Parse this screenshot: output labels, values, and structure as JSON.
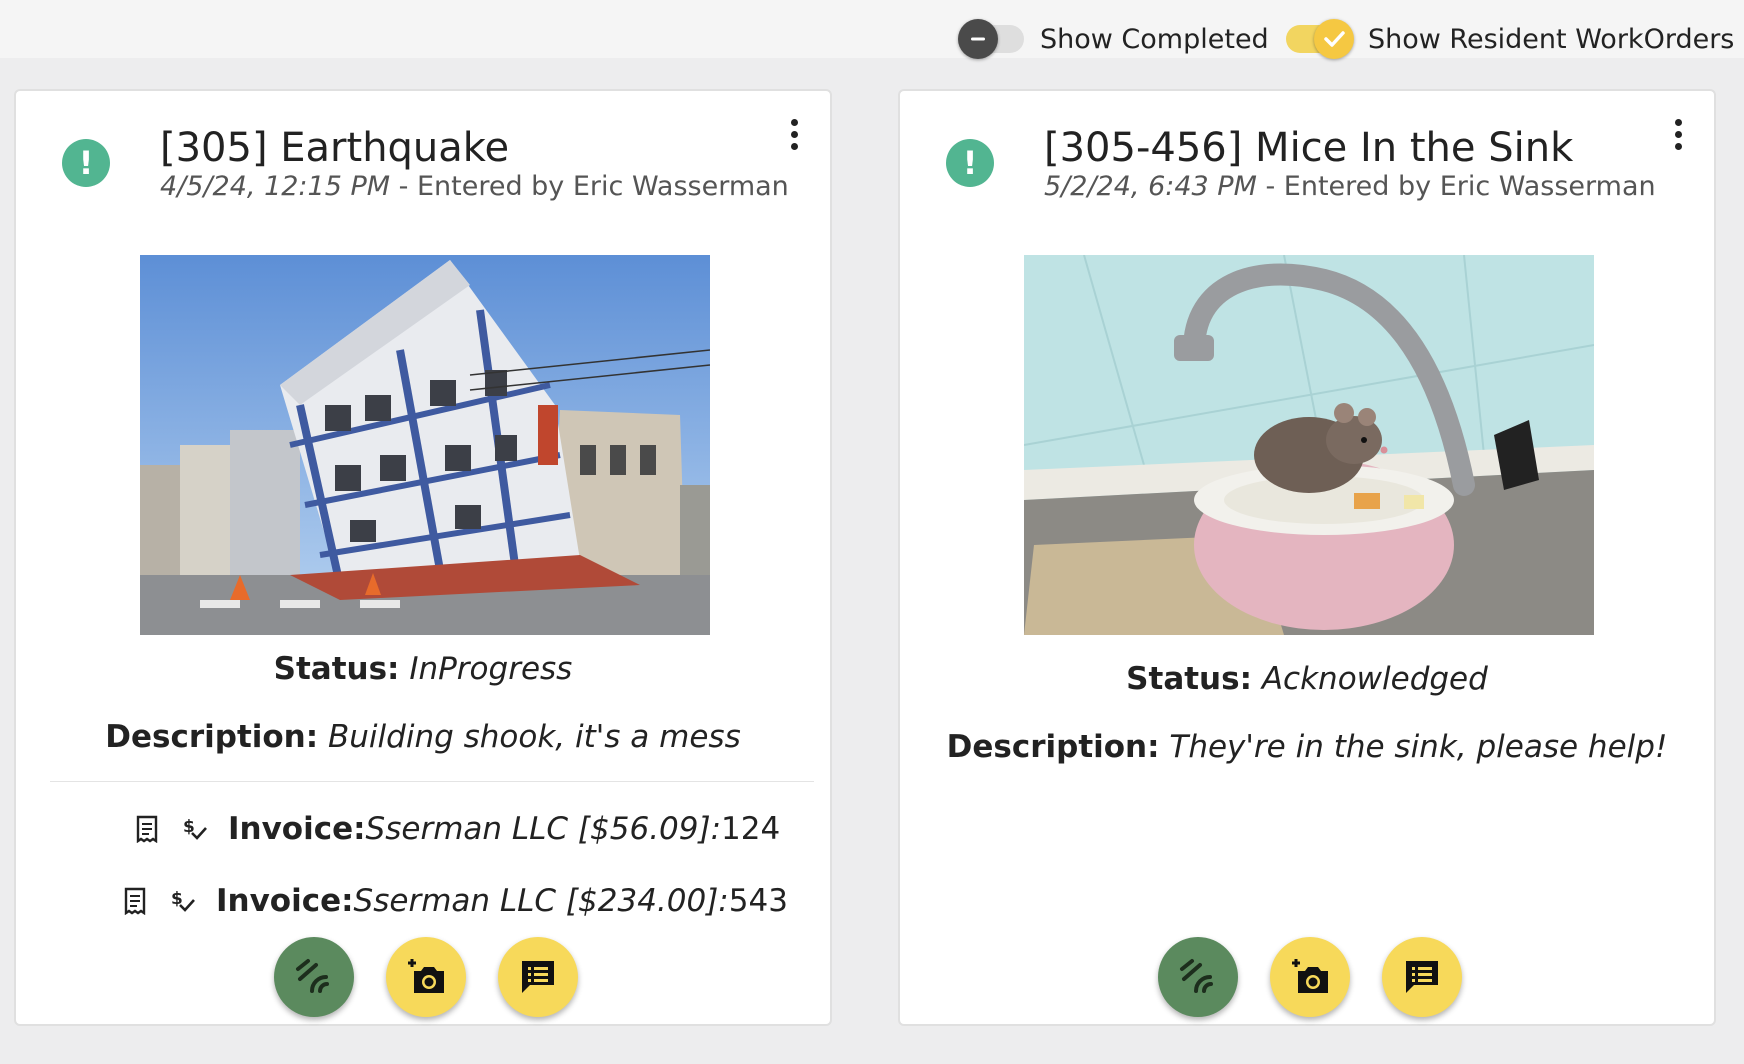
{
  "toolbar": {
    "show_completed_label": "Show Completed",
    "show_completed_on": false,
    "show_resident_label": "Show Resident WorkOrders",
    "show_resident_on": true
  },
  "colors": {
    "accent_yellow": "#f7d95a",
    "alert_green": "#52b591",
    "action_green": "#5b8a5e",
    "toggle_off_knob": "#4a4a4a"
  },
  "workorders": [
    {
      "title": "[305] Earthquake",
      "date": "4/5/24, 12:15 PM",
      "entered_by": " - Entered by Eric Wasserman",
      "alert_icon": "!",
      "image": "tilted-building-photo",
      "status_label": "Status:",
      "status_value": " InProgress",
      "description_label": "Description:",
      "description_value": " Building shook, it's a mess",
      "invoices": [
        {
          "label": "Invoice:",
          "vendor": "Sserman LLC [$56.09]:",
          "number": " 124"
        },
        {
          "label": "Invoice:",
          "vendor": "Sserman LLC [$234.00]:",
          "number": " 543"
        }
      ]
    },
    {
      "title": "[305-456] Mice In the Sink",
      "date": "5/2/24, 6:43 PM",
      "entered_by": " - Entered by Eric Wasserman",
      "alert_icon": "!",
      "image": "mouse-in-sink-photo",
      "status_label": "Status:",
      "status_value": " Acknowledged",
      "description_label": "Description:",
      "description_value": " They're in the sink, please help!",
      "invoices": []
    }
  ]
}
